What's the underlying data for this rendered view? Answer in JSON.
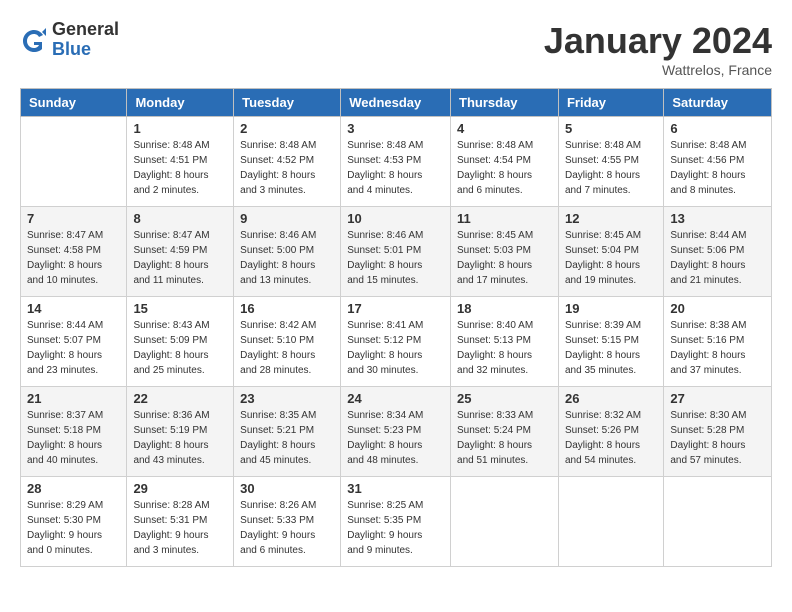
{
  "header": {
    "logo_general": "General",
    "logo_blue": "Blue",
    "month_title": "January 2024",
    "location": "Wattrelos, France"
  },
  "weekdays": [
    "Sunday",
    "Monday",
    "Tuesday",
    "Wednesday",
    "Thursday",
    "Friday",
    "Saturday"
  ],
  "weeks": [
    [
      {
        "day": "",
        "info": ""
      },
      {
        "day": "1",
        "info": "Sunrise: 8:48 AM\nSunset: 4:51 PM\nDaylight: 8 hours\nand 2 minutes."
      },
      {
        "day": "2",
        "info": "Sunrise: 8:48 AM\nSunset: 4:52 PM\nDaylight: 8 hours\nand 3 minutes."
      },
      {
        "day": "3",
        "info": "Sunrise: 8:48 AM\nSunset: 4:53 PM\nDaylight: 8 hours\nand 4 minutes."
      },
      {
        "day": "4",
        "info": "Sunrise: 8:48 AM\nSunset: 4:54 PM\nDaylight: 8 hours\nand 6 minutes."
      },
      {
        "day": "5",
        "info": "Sunrise: 8:48 AM\nSunset: 4:55 PM\nDaylight: 8 hours\nand 7 minutes."
      },
      {
        "day": "6",
        "info": "Sunrise: 8:48 AM\nSunset: 4:56 PM\nDaylight: 8 hours\nand 8 minutes."
      }
    ],
    [
      {
        "day": "7",
        "info": "Sunrise: 8:47 AM\nSunset: 4:58 PM\nDaylight: 8 hours\nand 10 minutes."
      },
      {
        "day": "8",
        "info": "Sunrise: 8:47 AM\nSunset: 4:59 PM\nDaylight: 8 hours\nand 11 minutes."
      },
      {
        "day": "9",
        "info": "Sunrise: 8:46 AM\nSunset: 5:00 PM\nDaylight: 8 hours\nand 13 minutes."
      },
      {
        "day": "10",
        "info": "Sunrise: 8:46 AM\nSunset: 5:01 PM\nDaylight: 8 hours\nand 15 minutes."
      },
      {
        "day": "11",
        "info": "Sunrise: 8:45 AM\nSunset: 5:03 PM\nDaylight: 8 hours\nand 17 minutes."
      },
      {
        "day": "12",
        "info": "Sunrise: 8:45 AM\nSunset: 5:04 PM\nDaylight: 8 hours\nand 19 minutes."
      },
      {
        "day": "13",
        "info": "Sunrise: 8:44 AM\nSunset: 5:06 PM\nDaylight: 8 hours\nand 21 minutes."
      }
    ],
    [
      {
        "day": "14",
        "info": "Sunrise: 8:44 AM\nSunset: 5:07 PM\nDaylight: 8 hours\nand 23 minutes."
      },
      {
        "day": "15",
        "info": "Sunrise: 8:43 AM\nSunset: 5:09 PM\nDaylight: 8 hours\nand 25 minutes."
      },
      {
        "day": "16",
        "info": "Sunrise: 8:42 AM\nSunset: 5:10 PM\nDaylight: 8 hours\nand 28 minutes."
      },
      {
        "day": "17",
        "info": "Sunrise: 8:41 AM\nSunset: 5:12 PM\nDaylight: 8 hours\nand 30 minutes."
      },
      {
        "day": "18",
        "info": "Sunrise: 8:40 AM\nSunset: 5:13 PM\nDaylight: 8 hours\nand 32 minutes."
      },
      {
        "day": "19",
        "info": "Sunrise: 8:39 AM\nSunset: 5:15 PM\nDaylight: 8 hours\nand 35 minutes."
      },
      {
        "day": "20",
        "info": "Sunrise: 8:38 AM\nSunset: 5:16 PM\nDaylight: 8 hours\nand 37 minutes."
      }
    ],
    [
      {
        "day": "21",
        "info": "Sunrise: 8:37 AM\nSunset: 5:18 PM\nDaylight: 8 hours\nand 40 minutes."
      },
      {
        "day": "22",
        "info": "Sunrise: 8:36 AM\nSunset: 5:19 PM\nDaylight: 8 hours\nand 43 minutes."
      },
      {
        "day": "23",
        "info": "Sunrise: 8:35 AM\nSunset: 5:21 PM\nDaylight: 8 hours\nand 45 minutes."
      },
      {
        "day": "24",
        "info": "Sunrise: 8:34 AM\nSunset: 5:23 PM\nDaylight: 8 hours\nand 48 minutes."
      },
      {
        "day": "25",
        "info": "Sunrise: 8:33 AM\nSunset: 5:24 PM\nDaylight: 8 hours\nand 51 minutes."
      },
      {
        "day": "26",
        "info": "Sunrise: 8:32 AM\nSunset: 5:26 PM\nDaylight: 8 hours\nand 54 minutes."
      },
      {
        "day": "27",
        "info": "Sunrise: 8:30 AM\nSunset: 5:28 PM\nDaylight: 8 hours\nand 57 minutes."
      }
    ],
    [
      {
        "day": "28",
        "info": "Sunrise: 8:29 AM\nSunset: 5:30 PM\nDaylight: 9 hours\nand 0 minutes."
      },
      {
        "day": "29",
        "info": "Sunrise: 8:28 AM\nSunset: 5:31 PM\nDaylight: 9 hours\nand 3 minutes."
      },
      {
        "day": "30",
        "info": "Sunrise: 8:26 AM\nSunset: 5:33 PM\nDaylight: 9 hours\nand 6 minutes."
      },
      {
        "day": "31",
        "info": "Sunrise: 8:25 AM\nSunset: 5:35 PM\nDaylight: 9 hours\nand 9 minutes."
      },
      {
        "day": "",
        "info": ""
      },
      {
        "day": "",
        "info": ""
      },
      {
        "day": "",
        "info": ""
      }
    ]
  ]
}
